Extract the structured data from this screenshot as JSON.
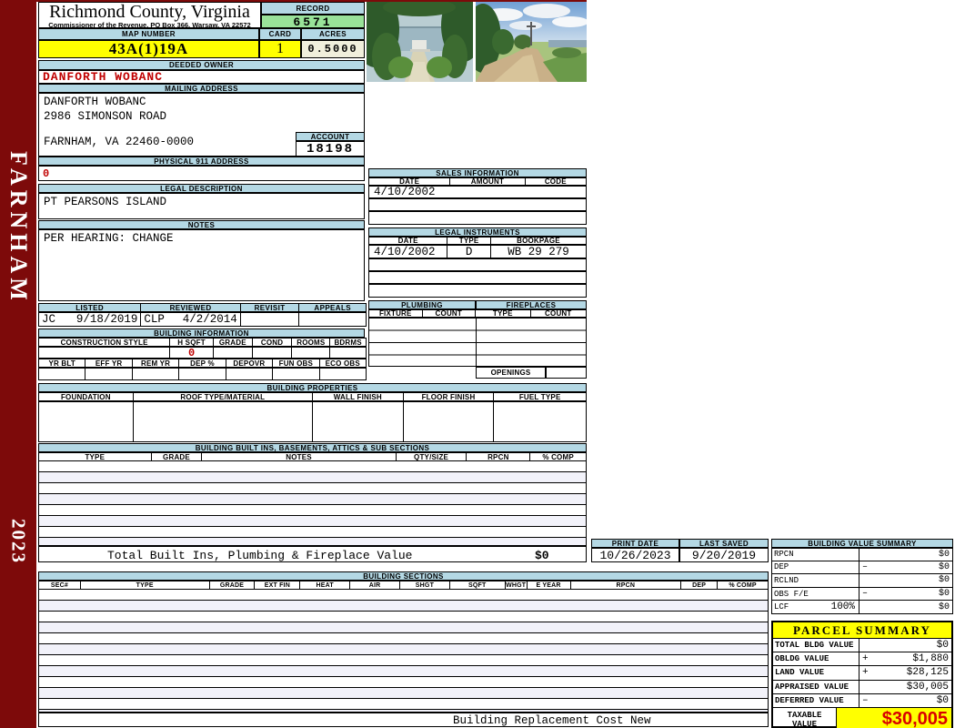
{
  "sidebar": {
    "district": "FARNHAM",
    "year": "2023"
  },
  "header": {
    "title": "Richmond County, Virginia",
    "subtitle": "Commissioner of the Revenue, PO Box 366, Warsaw, VA 22572",
    "record_label": "RECORD",
    "record_value": "6571",
    "map_label": "MAP NUMBER",
    "map_value": "43A(1)19A",
    "card_label": "CARD",
    "card_value": "1",
    "acres_label": "ACRES",
    "acres_value": "0.5000"
  },
  "owner": {
    "deeded_label": "DEEDED OWNER",
    "name": "DANFORTH WOBANC",
    "mailing_label": "MAILING ADDRESS",
    "address_line1": "DANFORTH WOBANC",
    "address_line2": "2986 SIMONSON ROAD",
    "address_line3": "FARNHAM, VA 22460-0000",
    "account_label": "ACCOUNT",
    "account_value": "18198",
    "physical_label": "PHYSICAL 911 ADDRESS",
    "physical_value": "0"
  },
  "legal": {
    "label": "LEGAL DESCRIPTION",
    "value": "PT PEARSONS ISLAND"
  },
  "notes": {
    "label": "NOTES",
    "value": "PER HEARING: CHANGE"
  },
  "review": {
    "headers": [
      "LISTED",
      "REVIEWED",
      "REVISIT",
      "APPEALS"
    ],
    "listed_by": "JC",
    "listed_date": "9/18/2019",
    "reviewed_by": "CLP",
    "reviewed_date": "4/2/2014",
    "revisit": "",
    "appeals": ""
  },
  "building_info": {
    "label": "BUILDING INFORMATION",
    "row1_headers": [
      "CONSTRUCTION STYLE",
      "H SQFT",
      "GRADE",
      "COND",
      "ROOMS",
      "BDRMS"
    ],
    "hsqft_value": "0",
    "row2_headers": [
      "YR BLT",
      "EFF YR",
      "REM YR",
      "DEP %",
      "DEPOVR",
      "FUN OBS",
      "ECO OBS"
    ]
  },
  "sales": {
    "label": "SALES INFORMATION",
    "headers": [
      "DATE",
      "AMOUNT",
      "CODE"
    ],
    "row1": {
      "date": "4/10/2002",
      "amount": "",
      "code": ""
    }
  },
  "instruments": {
    "label": "LEGAL INSTRUMENTS",
    "headers": [
      "DATE",
      "TYPE",
      "BOOKPAGE"
    ],
    "row1": {
      "date": "4/10/2002",
      "type": "D",
      "bookpage": "WB 29 279"
    }
  },
  "plumbing": {
    "label": "PLUMBING",
    "headers": [
      "FIXTURE",
      "COUNT"
    ]
  },
  "fireplaces": {
    "label": "FIREPLACES",
    "headers": [
      "TYPE",
      "COUNT"
    ],
    "openings_label": "OPENINGS"
  },
  "properties": {
    "label": "BUILDING PROPERTIES",
    "headers": [
      "FOUNDATION",
      "ROOF TYPE/MATERIAL",
      "WALL FINISH",
      "FLOOR FINISH",
      "FUEL TYPE"
    ]
  },
  "builtins": {
    "label": "BUILDING BUILT INS, BASEMENTS, ATTICS & SUB SECTIONS",
    "headers": [
      "TYPE",
      "GRADE",
      "NOTES",
      "QTY/SIZE",
      "RPCN",
      "% COMP"
    ],
    "total_label": "Total Built Ins, Plumbing & Fireplace Value",
    "total_value": "$0"
  },
  "dates": {
    "print_label": "PRINT DATE",
    "print_value": "10/26/2023",
    "saved_label": "LAST SAVED",
    "saved_value": "9/20/2019"
  },
  "value_summary": {
    "label": "BUILDING VALUE SUMMARY",
    "rows": [
      {
        "label": "RPCN",
        "op": "",
        "value": "$0"
      },
      {
        "label": "DEP",
        "op": "–",
        "value": "$0"
      },
      {
        "label": "RCLND",
        "op": "",
        "value": "$0"
      },
      {
        "label": "OBS F/E",
        "op": "–",
        "value": "$0"
      },
      {
        "label": "LCF",
        "pct": "100%",
        "op": "",
        "value": "$0"
      }
    ]
  },
  "sections": {
    "label": "BUILDING SECTIONS",
    "headers": [
      "SEC#",
      "TYPE",
      "GRADE",
      "EXT FIN",
      "HEAT",
      "AIR",
      "SHGT",
      "SQFT",
      "WHGT",
      "E YEAR",
      "RPCN",
      "DEP",
      "% COMP"
    ],
    "footer": "Building Replacement Cost New"
  },
  "parcel": {
    "label": "PARCEL SUMMARY",
    "rows": [
      {
        "label": "TOTAL BLDG VALUE",
        "op": "",
        "value": "$0"
      },
      {
        "label": "OBLDG VALUE",
        "op": "+",
        "value": "$1,880"
      },
      {
        "label": "LAND VALUE",
        "op": "+",
        "value": "$28,125"
      },
      {
        "label": "APPRAISED VALUE",
        "op": "",
        "value": "$30,005"
      },
      {
        "label": "DEFERRED VALUE",
        "op": "–",
        "value": "$0"
      }
    ],
    "taxable_label1": "TAXABLE",
    "taxable_label2": "VALUE",
    "taxable_value": "$30,005"
  },
  "colors": {
    "maroon": "#7d0a0a",
    "header_blue": "#b4d8e4",
    "record_green": "#99e299",
    "highlight_yellow": "#ffff00",
    "acres_cream": "#f0efdc",
    "alert_red": "#c00000"
  }
}
